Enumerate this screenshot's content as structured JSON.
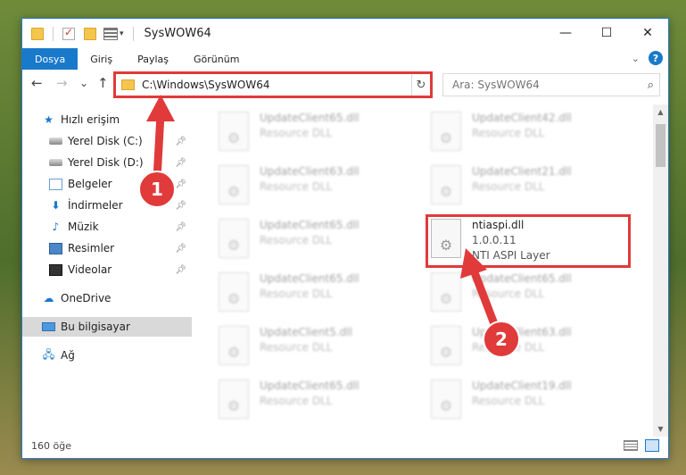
{
  "window": {
    "title": "SysWOW64",
    "minimize_glyph": "—",
    "maximize_glyph": "☐",
    "close_glyph": "✕"
  },
  "ribbon": {
    "tabs": [
      {
        "label": "Dosya",
        "active": true
      },
      {
        "label": "Giriş",
        "active": false
      },
      {
        "label": "Paylaş",
        "active": false
      },
      {
        "label": "Görünüm",
        "active": false
      }
    ],
    "help_glyph": "?"
  },
  "navigation": {
    "back_glyph": "←",
    "forward_glyph": "→",
    "recent_glyph": "⌄",
    "up_glyph": "↑",
    "address_path": "C:\\Windows\\SysWOW64",
    "refresh_glyph": "↻",
    "search_placeholder": "Ara: SysWOW64"
  },
  "sidebar": {
    "quick_access": "Hızlı erişim",
    "items": [
      {
        "label": "Yerel Disk (C:)",
        "icon": "drive-icon",
        "pinned": true
      },
      {
        "label": "Yerel Disk (D:)",
        "icon": "drive-icon",
        "pinned": true
      },
      {
        "label": "Belgeler",
        "icon": "documents-icon",
        "pinned": true
      },
      {
        "label": "İndirmeler",
        "icon": "downloads-icon",
        "pinned": true
      },
      {
        "label": "Müzik",
        "icon": "music-icon",
        "pinned": true
      },
      {
        "label": "Resimler",
        "icon": "pictures-icon",
        "pinned": true
      },
      {
        "label": "Videolar",
        "icon": "videos-icon",
        "pinned": true
      }
    ],
    "onedrive": "OneDrive",
    "this_pc": "Bu bilgisayar",
    "network": "Ağ"
  },
  "files": {
    "left_column": [
      {
        "name": "UpdateClient65.dll",
        "type": "Resource DLL"
      },
      {
        "name": "UpdateClient63.dll",
        "type": "Resource DLL"
      },
      {
        "name": "UpdateClient65.dll",
        "type": "Resource DLL"
      },
      {
        "name": "UpdateClient65.dll",
        "type": "Resource DLL"
      },
      {
        "name": "UpdateClient5.dll",
        "type": "Resource DLL"
      },
      {
        "name": "UpdateClient65.dll",
        "type": "Resource DLL"
      }
    ],
    "right_column": [
      {
        "name": "UpdateClient42.dll",
        "type": "Resource DLL"
      },
      {
        "name": "UpdateClient21.dll",
        "type": "Resource DLL"
      },
      {
        "name": "ntiaspi.dll",
        "version": "1.0.0.11",
        "type": "NTI ASPI Layer",
        "highlighted": true
      },
      {
        "name": "UpdateClient65.dll",
        "type": "Resource DLL"
      },
      {
        "name": "UpdateClient63.dll",
        "type": "Resource DLL"
      },
      {
        "name": "UpdateClient19.dll",
        "type": "Resource DLL"
      }
    ]
  },
  "status": {
    "item_count": "160 öğe"
  },
  "annotations": {
    "step1": "1",
    "step2": "2",
    "highlight_color": "#e03a3a"
  },
  "colors": {
    "accent": "#1979ca",
    "highlight": "#e03a3a"
  }
}
